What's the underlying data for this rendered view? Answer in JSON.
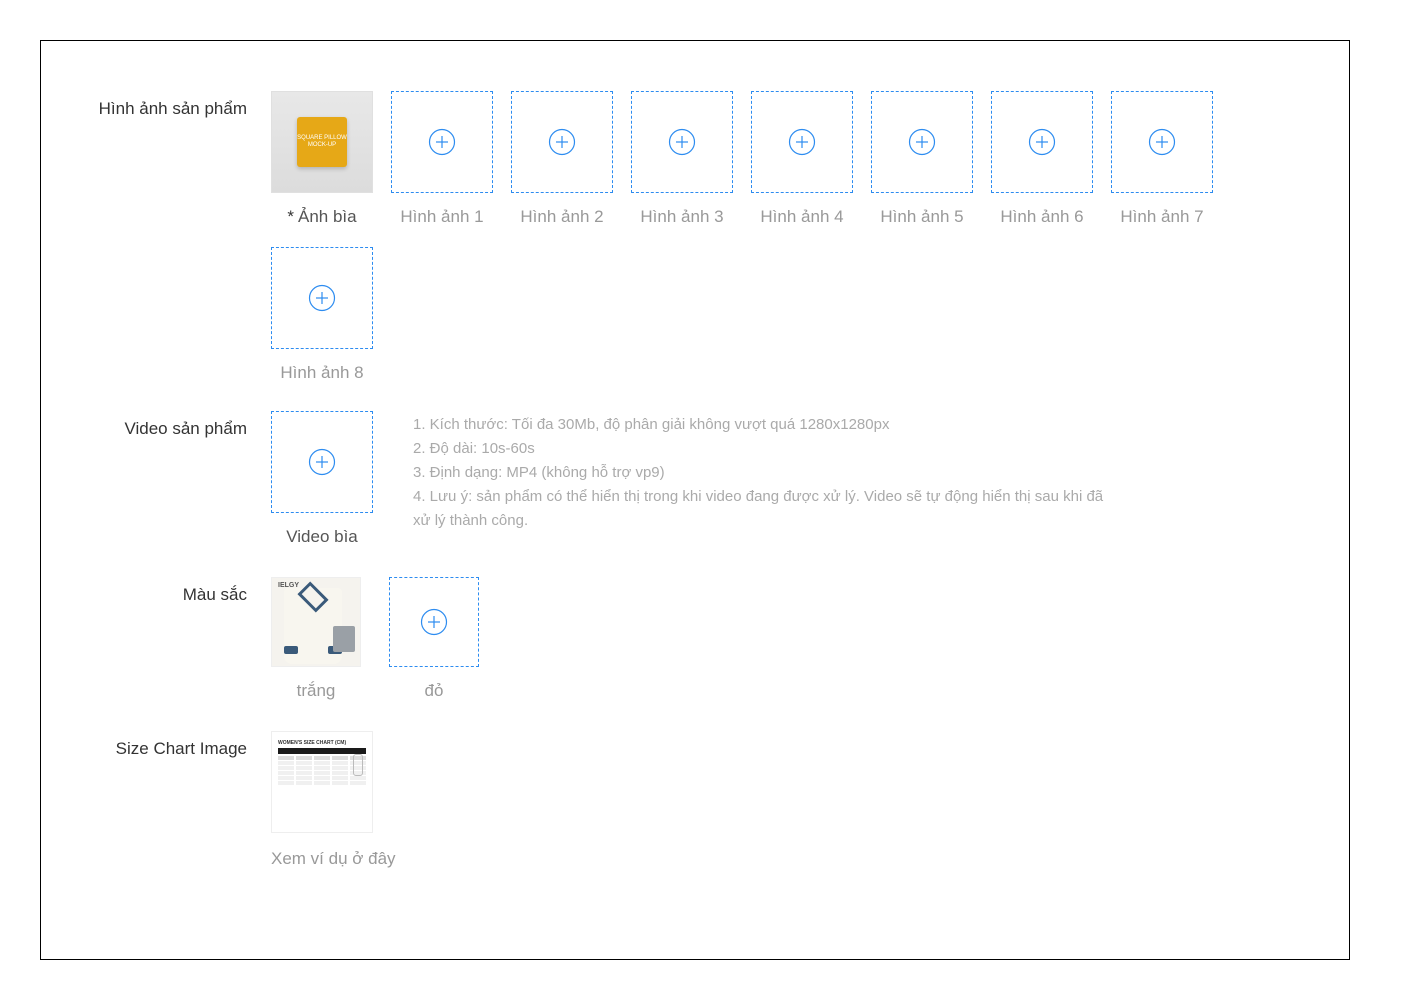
{
  "sections": {
    "images_label": "Hình ảnh sản phẩm",
    "video_label": "Video sản phẩm",
    "color_label": "Màu sắc",
    "size_chart_label": "Size Chart Image"
  },
  "image_slots": {
    "cover_prefix": "*",
    "cover_caption": "Ảnh bìa",
    "slot1": "Hình ảnh 1",
    "slot2": "Hình ảnh 2",
    "slot3": "Hình ảnh 3",
    "slot4": "Hình ảnh 4",
    "slot5": "Hình ảnh 5",
    "slot6": "Hình ảnh 6",
    "slot7": "Hình ảnh 7",
    "slot8": "Hình ảnh 8"
  },
  "pillow_text": "SQUARE PILLOW MOCK-UP",
  "video": {
    "caption": "Video bìa",
    "line1": "1. Kích thước: Tối đa 30Mb, độ phân giải không vượt quá 1280x1280px",
    "line2": "2. Độ dài: 10s-60s",
    "line3": "3. Định dạng: MP4 (không hỗ trợ vp9)",
    "line4": "4. Lưu ý: sản phẩm có thể hiển thị trong khi video đang được xử lý. Video sẽ tự động hiển thị sau khi đã xử lý thành công."
  },
  "colors": {
    "white_label": "trắng",
    "red_label": "đỏ",
    "brand_tag": "IELGY"
  },
  "size_chart": {
    "example_link": "Xem ví dụ ở đây",
    "inner_title": "WOMEN'S SIZE CHART (CM)"
  }
}
